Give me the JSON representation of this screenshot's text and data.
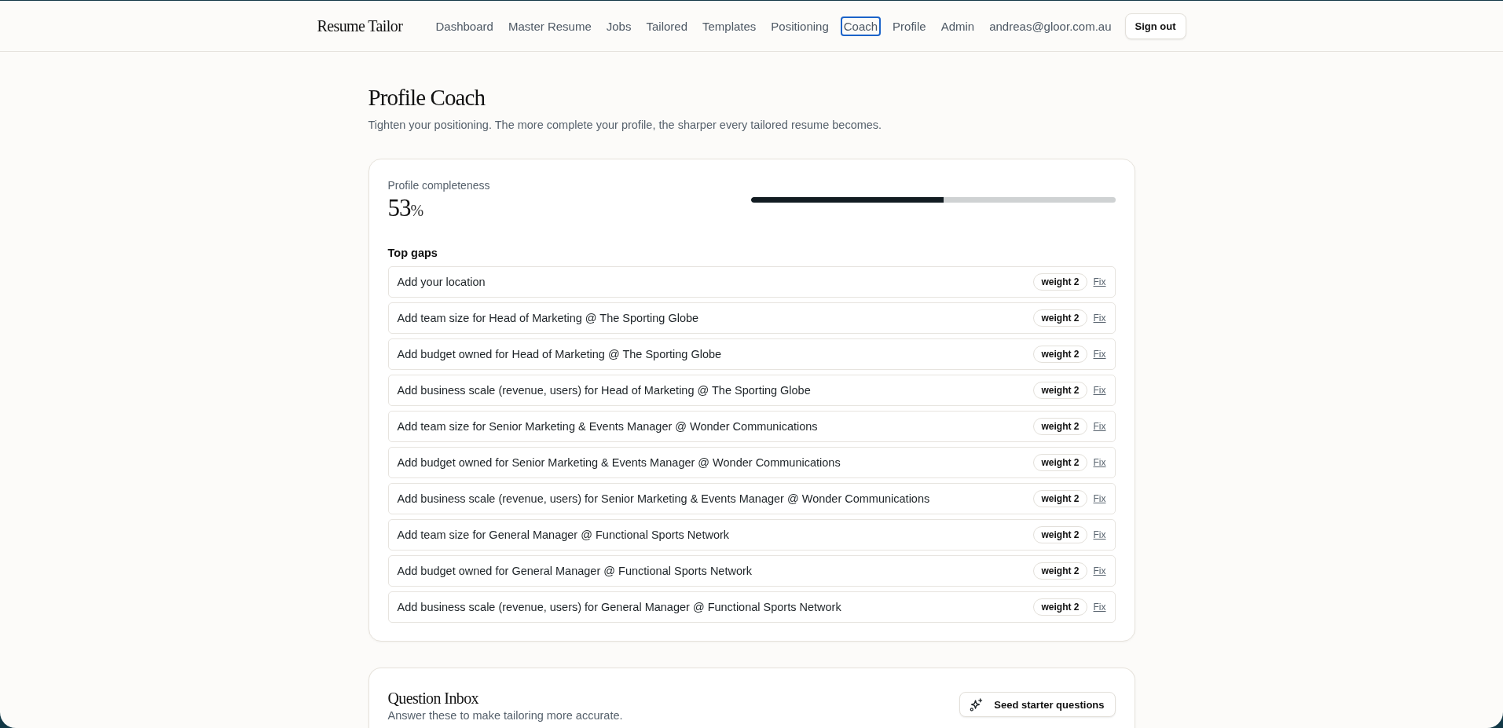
{
  "app": {
    "name": "Resume Tailor"
  },
  "nav": {
    "links": [
      {
        "label": "Dashboard",
        "selected": false
      },
      {
        "label": "Master Resume",
        "selected": false
      },
      {
        "label": "Jobs",
        "selected": false
      },
      {
        "label": "Tailored",
        "selected": false
      },
      {
        "label": "Templates",
        "selected": false
      },
      {
        "label": "Positioning",
        "selected": false
      },
      {
        "label": "Coach",
        "selected": true
      },
      {
        "label": "Profile",
        "selected": false
      },
      {
        "label": "Admin",
        "selected": false
      }
    ],
    "account": "andreas@gloor.com.au",
    "sign_out": "Sign out"
  },
  "page": {
    "title": "Profile Coach",
    "subtitle": "Tighten your positioning. The more complete your profile, the sharper every tailored resume becomes."
  },
  "completeness": {
    "label": "Profile completeness",
    "value": "53",
    "unit": "%",
    "level": 0.53
  },
  "top_gaps": {
    "heading": "Top gaps",
    "items": [
      {
        "text": "Add your location",
        "badge": "weight 2",
        "action": "Fix"
      },
      {
        "text": "Add team size for Head of Marketing @ The Sporting Globe",
        "badge": "weight 2",
        "action": "Fix"
      },
      {
        "text": "Add budget owned for Head of Marketing @ The Sporting Globe",
        "badge": "weight 2",
        "action": "Fix"
      },
      {
        "text": "Add business scale (revenue, users) for Head of Marketing @ The Sporting Globe",
        "badge": "weight 2",
        "action": "Fix"
      },
      {
        "text": "Add team size for Senior Marketing & Events Manager @ Wonder Communications",
        "badge": "weight 2",
        "action": "Fix"
      },
      {
        "text": "Add budget owned for Senior Marketing & Events Manager @ Wonder Communications",
        "badge": "weight 2",
        "action": "Fix"
      },
      {
        "text": "Add business scale (revenue, users) for Senior Marketing & Events Manager @ Wonder Communications",
        "badge": "weight 2",
        "action": "Fix"
      },
      {
        "text": "Add team size for General Manager @ Functional Sports Network",
        "badge": "weight 2",
        "action": "Fix"
      },
      {
        "text": "Add budget owned for General Manager @ Functional Sports Network",
        "badge": "weight 2",
        "action": "Fix"
      },
      {
        "text": "Add business scale (revenue, users) for General Manager @ Functional Sports Network",
        "badge": "weight 2",
        "action": "Fix"
      }
    ]
  },
  "question_inbox": {
    "title": "Question Inbox",
    "subtitle": "Answer these to make tailoring more accurate.",
    "button": "Seed starter questions"
  }
}
